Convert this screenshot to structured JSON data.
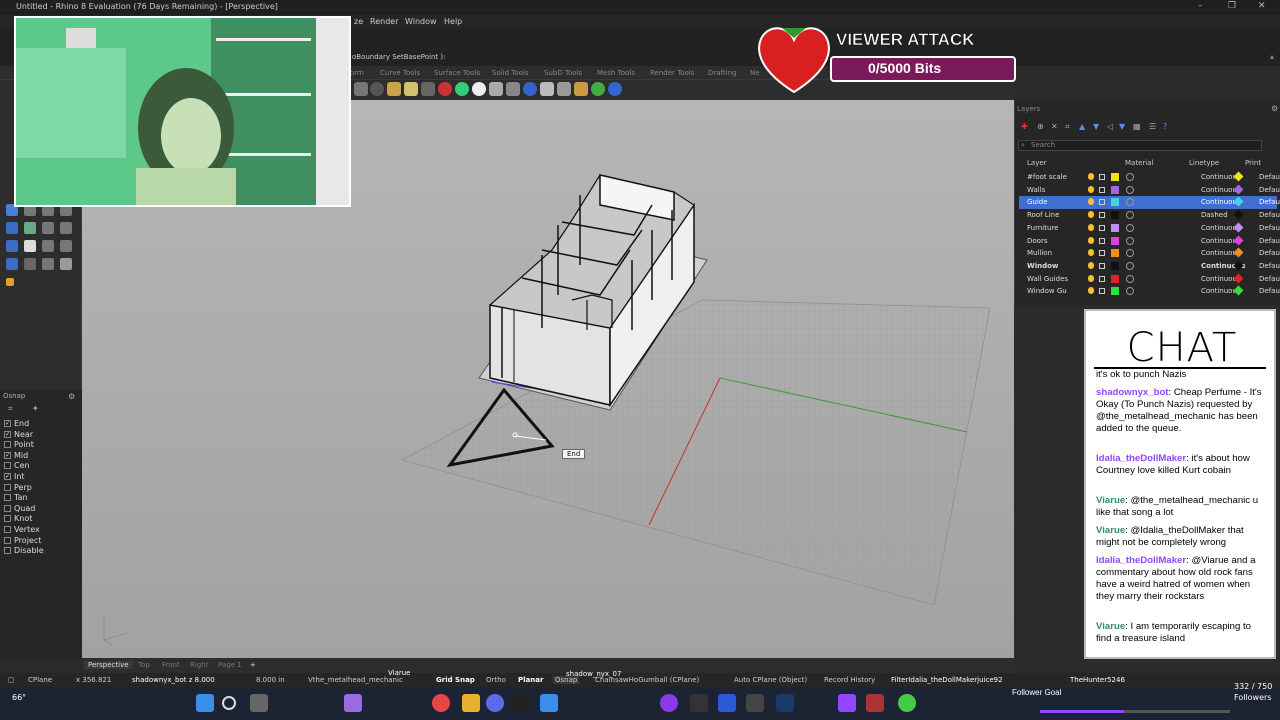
{
  "app": {
    "window_title": "Untitled - Rhino 8 Evaluation (76 Days Remaining) - [Perspective]",
    "menu": [
      "ze",
      "Render",
      "Window",
      "Help"
    ],
    "command_history": "oBoundary  SetBasePoint ):",
    "toolbar_tabs": [
      "orm",
      "Curve Tools",
      "Surface Tools",
      "Solid Tools",
      "SubD Tools",
      "Mesh Tools",
      "Render Tools",
      "Drafting",
      "Ne"
    ]
  },
  "osnap": {
    "title": "Osnap",
    "items": [
      {
        "label": "End",
        "checked": true
      },
      {
        "label": "Near",
        "checked": true
      },
      {
        "label": "Point",
        "checked": false
      },
      {
        "label": "Mid",
        "checked": true
      },
      {
        "label": "Cen",
        "checked": false
      },
      {
        "label": "Int",
        "checked": true
      },
      {
        "label": "Perp",
        "checked": false
      },
      {
        "label": "Tan",
        "checked": false
      },
      {
        "label": "Quad",
        "checked": false
      },
      {
        "label": "Knot",
        "checked": false
      },
      {
        "label": "Vertex",
        "checked": false
      },
      {
        "label": "Project",
        "checked": false
      },
      {
        "label": "Disable",
        "checked": false
      }
    ]
  },
  "viewport": {
    "osnap_tooltip": "End",
    "tabs": [
      "Perspective",
      "Top",
      "Front",
      "Right",
      "Page 1",
      "+"
    ]
  },
  "layers": {
    "title": "Layers",
    "search_placeholder": "Search",
    "columns": {
      "layer": "Layer",
      "material": "Material",
      "linetype": "Linetype",
      "print": "Print"
    },
    "rows": [
      {
        "name": "#foot scale",
        "color": "#f2e318",
        "linetype": "Continuous",
        "print": "Defau",
        "print_color": "#f2e318",
        "selected": false
      },
      {
        "name": "Walls",
        "color": "#a566e0",
        "linetype": "Continuous",
        "print": "Defau",
        "print_color": "#a566e0",
        "selected": false
      },
      {
        "name": "Guide",
        "color": "#3fd6e8",
        "linetype": "Continuous",
        "print": "Defau",
        "print_color": "#3fd6e8",
        "selected": true
      },
      {
        "name": "Roof Line",
        "color": "#111111",
        "linetype": "Dashed",
        "print": "Defau",
        "print_color": "#111111",
        "selected": false
      },
      {
        "name": "Furniture",
        "color": "#c08ef2",
        "linetype": "Continuous",
        "print": "Defau",
        "print_color": "#c08ef2",
        "selected": false
      },
      {
        "name": "Doors",
        "color": "#e040e0",
        "linetype": "Continuous",
        "print": "Defau",
        "print_color": "#e040e0",
        "selected": false
      },
      {
        "name": "Mullion",
        "color": "#f28c1a",
        "linetype": "Continuous",
        "print": "Defau",
        "print_color": "#f28c1a",
        "selected": false
      },
      {
        "name": "Window",
        "color": "#111111",
        "linetype": "Continuous",
        "print": "Defau",
        "print_color": "#111111",
        "selected": false
      },
      {
        "name": "Wall Guides",
        "color": "#e82020",
        "linetype": "Continuous",
        "print": "Defau",
        "print_color": "#e82020",
        "selected": false
      },
      {
        "name": "Window Gu",
        "color": "#2ee03a",
        "linetype": "Continuous",
        "print": "Defau",
        "print_color": "#2ee03a",
        "selected": false
      }
    ]
  },
  "statusbar": {
    "cplane": "CPlane",
    "x": "x 356.821",
    "y": "shadownyx_bot z 8.000",
    "units": "8.000 in",
    "layer": "Vthe_metalhead_mechanic",
    "grid_snap": "Grid Snap",
    "ortho": "Ortho",
    "planar": "Planar",
    "osnap": "Osnap",
    "gumball": "ChainsawHoGumball (CPlane)",
    "auto_cplane": "Auto CPlane (Object)",
    "record_history": "Record History",
    "filter": "FilterIdalia_theDollMakerjuice92",
    "follower_goal": "Follower Goal",
    "follower_user": "TheHunter5246",
    "follower_count": "332 / 750",
    "followers_label": "Followers",
    "shadow_label": "shadow_nyx_07",
    "viarue_label": "Viarue",
    "temp": "66°"
  },
  "overlay": {
    "viewer_attack_title": "VIEWER ATTACK",
    "viewer_attack_bits": "0/5000 Bits"
  },
  "chat": {
    "title": "CHAT",
    "messages": [
      {
        "user": "",
        "text": "it's ok to punch Nazis",
        "user_color": "#000"
      },
      {
        "user": "shadownyx_bot",
        "text": "Cheap Perfume - It's Okay (To Punch Nazis) requested by @the_metalhead_mechanic has been added to the queue.",
        "user_color": "#9147ff"
      },
      {
        "user": "Idalia_theDollMaker",
        "text": "it's about how Courtney love killed Kurt cobain",
        "user_color": "#9147ff"
      },
      {
        "user": "Viarue",
        "text": "@the_metalhead_mechanic u like that song a lot",
        "user_color": "#2e8b7a"
      },
      {
        "user": "Viarue",
        "text": "@Idalia_theDollMaker that might not be completely wrong",
        "user_color": "#2e8b7a"
      },
      {
        "user": "Idalia_theDollMaker",
        "text": "@Viarue and a commentary about how old rock fans have a weird hatred of women when they marry their rockstars",
        "user_color": "#9147ff"
      },
      {
        "user": "Viarue",
        "text": "I am temporarily escaping to find a treasure island",
        "user_color": "#2e8b7a"
      }
    ]
  }
}
